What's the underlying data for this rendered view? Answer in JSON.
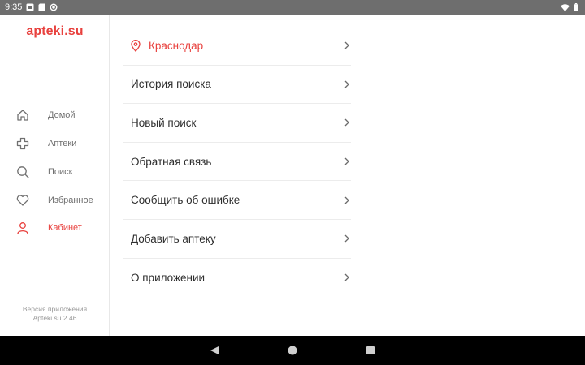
{
  "status_bar": {
    "time": "9:35"
  },
  "app": {
    "logo_text": "apteki.su",
    "accent_color": "#e8413e"
  },
  "sidebar": {
    "items": [
      {
        "label": "Домой",
        "icon": "home-icon",
        "active": false
      },
      {
        "label": "Аптеки",
        "icon": "plus-icon",
        "active": false
      },
      {
        "label": "Поиск",
        "icon": "search-icon",
        "active": false
      },
      {
        "label": "Избранное",
        "icon": "heart-icon",
        "active": false
      },
      {
        "label": "Кабинет",
        "icon": "user-icon",
        "active": true
      }
    ],
    "version_line1": "Версия приложения",
    "version_line2": "Apteki.su 2.46"
  },
  "menu": {
    "items": [
      {
        "label": "Краснодар",
        "icon": "location-pin-icon"
      },
      {
        "label": "История поиска"
      },
      {
        "label": "Новый поиск"
      },
      {
        "label": "Обратная связь"
      },
      {
        "label": "Сообщить об ошибке"
      },
      {
        "label": "Добавить аптеку"
      },
      {
        "label": "О приложении"
      }
    ]
  }
}
